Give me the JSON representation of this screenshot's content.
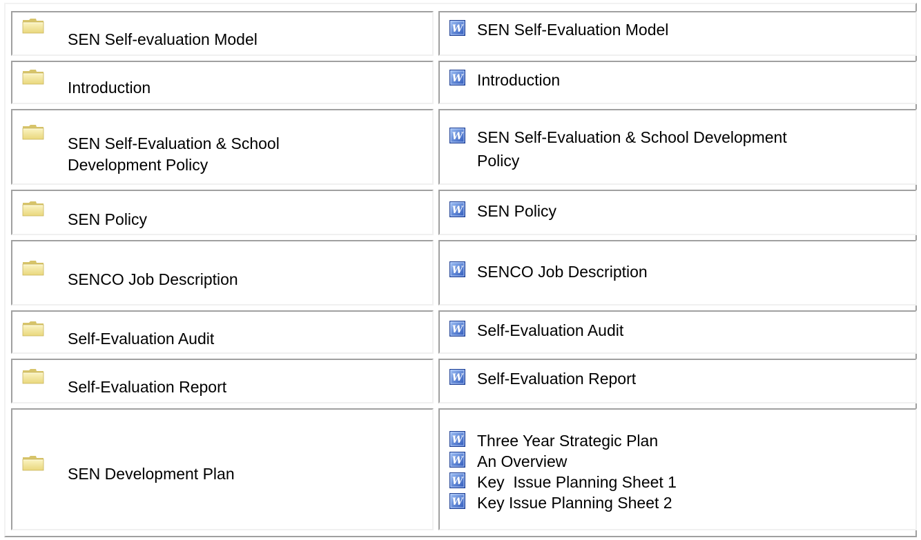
{
  "rows": [
    {
      "folder_label": "SEN Self-evaluation Model",
      "doc_label": "SEN Self-Evaluation Model"
    },
    {
      "folder_label": "Introduction",
      "doc_label": "Introduction"
    },
    {
      "folder_label_line1": "SEN Self-Evaluation & School",
      "folder_label_line2": "Development Policy",
      "doc_label_line1": "SEN Self-Evaluation & School Development",
      "doc_label_line2": "Policy"
    },
    {
      "folder_label": "SEN Policy",
      "doc_label": "SEN Policy"
    },
    {
      "folder_label": "SENCO Job Description",
      "doc_label": "SENCO Job Description"
    },
    {
      "folder_label": "Self-Evaluation Audit",
      "doc_label": "Self-Evaluation Audit"
    },
    {
      "folder_label": "Self-Evaluation Report",
      "doc_label": "Self-Evaluation Report"
    },
    {
      "folder_label": "SEN Development Plan",
      "docs": [
        "Three Year Strategic Plan",
        "An Overview",
        "Key  Issue Planning Sheet 1",
        "Key Issue Planning Sheet 2"
      ]
    }
  ],
  "icons": {
    "folder": "folder-icon",
    "word": "word-document-icon"
  },
  "colors": {
    "folder_body": "#f3e79a",
    "folder_tab": "#d9c869",
    "word_blue": "#3a64c8",
    "cell_border_dark": "#a0a0a0",
    "cell_border_light": "#f0f0f0"
  }
}
